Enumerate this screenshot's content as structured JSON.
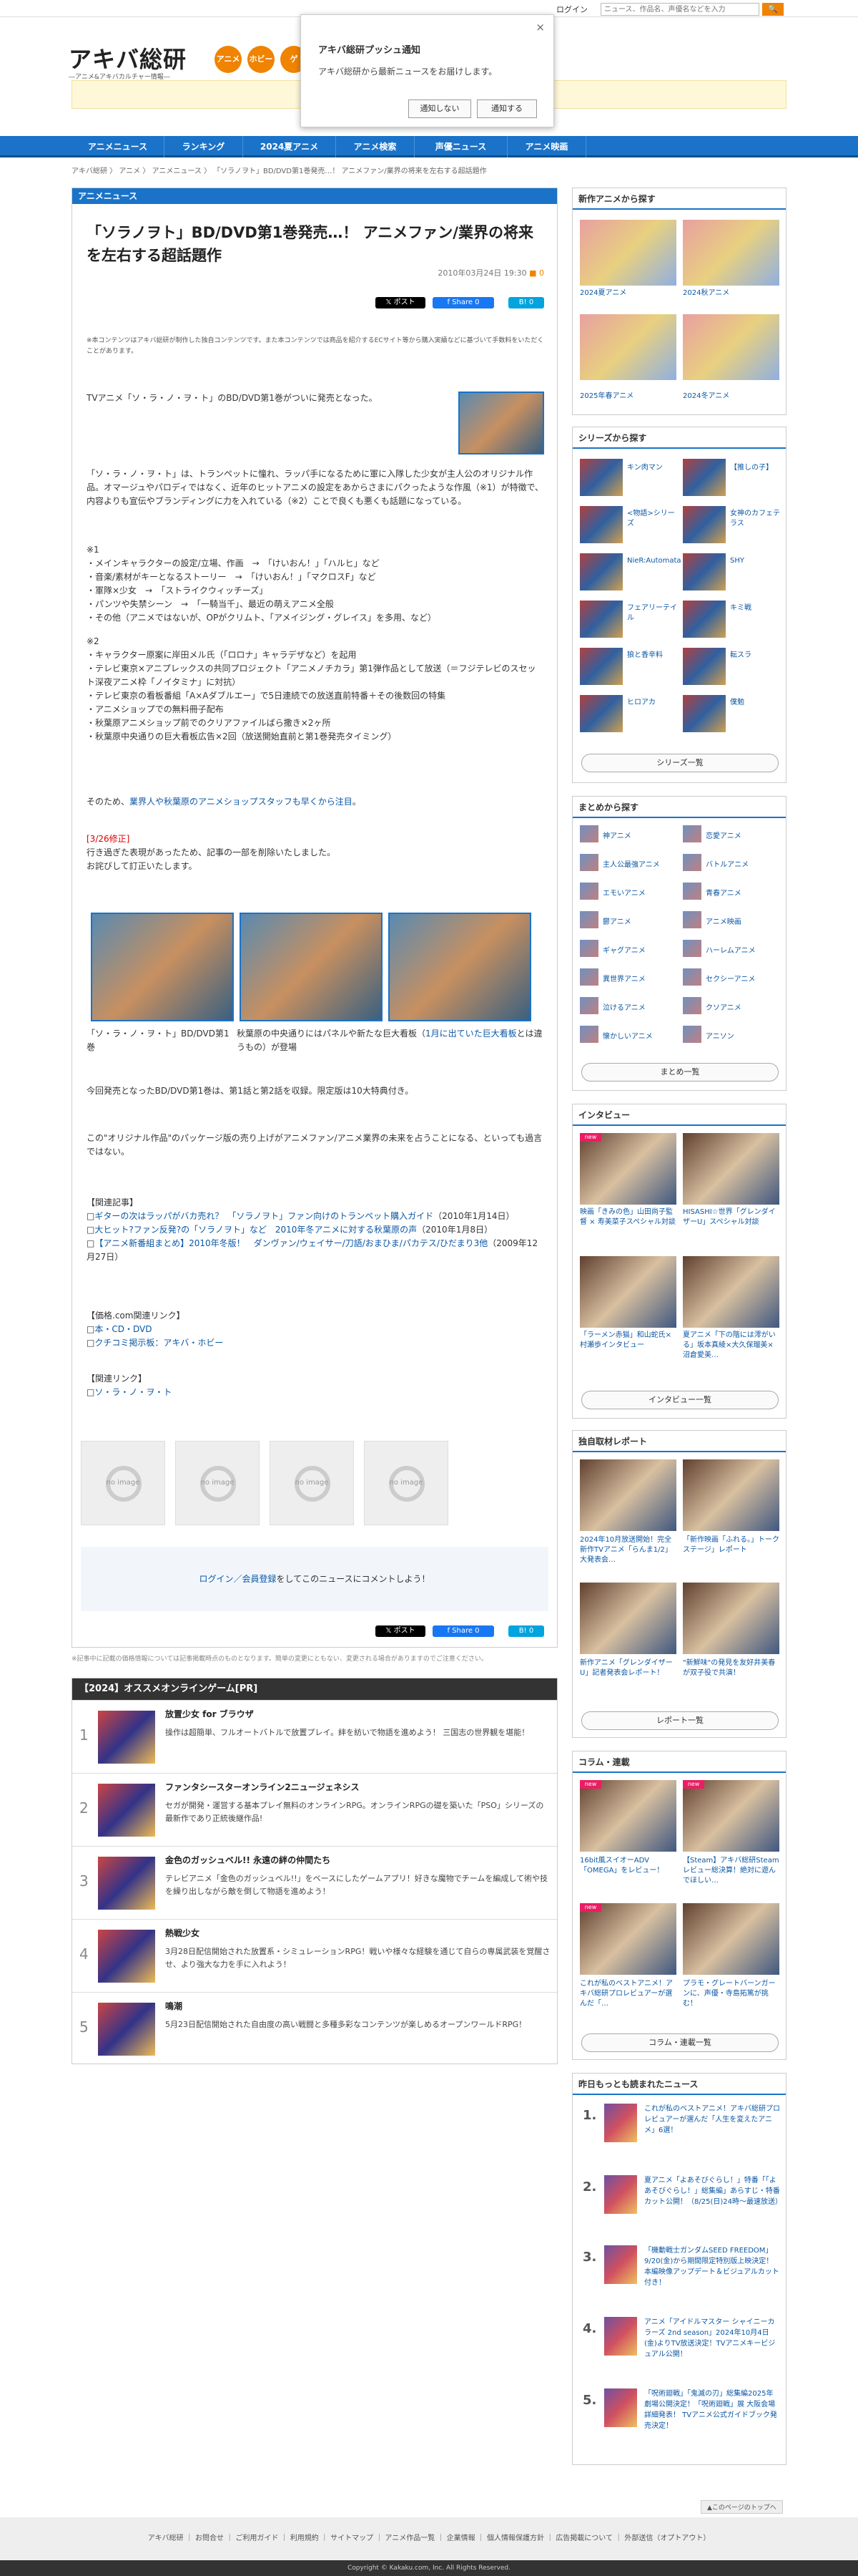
{
  "topbar": {
    "login": "ログイン",
    "search_placeholder": "ニュース、作品名、声優名などを入力",
    "search_button": "🔍"
  },
  "logo": {
    "text": "アキバ総研",
    "sub": "―アニメ&アキバカルチャー情報―"
  },
  "circles": [
    "アニメ",
    "ホビー",
    "ゲ"
  ],
  "popup": {
    "title": "アキバ総研プッシュ通知",
    "body": "アキバ総研から最新ニュースをお届けします。",
    "deny": "通知しない",
    "allow": "通知する",
    "close": "×"
  },
  "nav": [
    "アニメニュース",
    "ランキング",
    "2024夏アニメ",
    "アニメ検索",
    "声優ニュース",
    "アニメ映画"
  ],
  "breadcrumb": "アキバ総研 〉 アニメ 〉 アニメニュース 〉 「ソラノヲト」BD/DVD第1巻発売…！ アニメファン/業界の将来を左右する超話題作",
  "article": {
    "section": "アニメニュース",
    "title": "「ソラノヲト」BD/DVD第1巻発売…！ アニメファン/業界の将来を左右する超話題作",
    "date": "2010年03月24日 19:30",
    "comments": "0",
    "share": [
      "𝕏 ポスト",
      "f Share 0",
      "B! 0"
    ],
    "note": "※本コンテンツはアキバ総研が制作した独自コンテンツです。また本コンテンツでは商品を紹介するECサイト等から購入実績などに基づいて手数料をいただくことがあります。",
    "p1": "TVアニメ「ソ・ラ・ノ・ヲ・ト」のBD/DVD第1巻がついに発売となった。",
    "p2": "「ソ・ラ・ノ・ヲ・ト」は、トランペットに憧れ、ラッパ手になるために軍に入隊した少女が主人公のオリジナル作品。オマージュやパロディではなく、近年のヒットアニメの設定をあからさまにパクったような作風（※1）が特徴で、内容よりも宣伝やブランディングに力を入れている（※2）ことで良くも悪くも話題になっている。",
    "list1_title": "※1",
    "list1": [
      "・メインキャラクターの設定/立場、作画　→　「けいおん！」「ハルヒ」など",
      "・音楽/素材がキーとなるストーリー　→　「けいおん！」「マクロスF」など",
      "・軍隊×少女　→　「ストライクウィッチーズ」",
      "・パンツや失禁シーン　→　「一騎当千」、最近の萌えアニメ全般",
      "・その他（アニメではないが、OPがクリムト、「アメイジング・グレイス」を多用、など）"
    ],
    "list2_title": "※2",
    "list2": [
      "・キャラクター原案に岸田メル氏（「ロロナ」キャラデザなど）を起用",
      "・テレビ東京×アニプレックスの共同プロジェクト「アニメノチカラ」第1弾作品として放送（＝フジテレビのスセット深夜アニメ枠「ノイタミナ」に対抗）",
      "・テレビ東京の看板番組「A×Aダブルエー」で5日連続での放送直前特番＋その後数回の特集",
      "・アニメショップでの無料冊子配布",
      "・秋葉原アニメショップ前でのクリアファイルばら撒き×2ヶ所",
      "・秋葉原中央通りの巨大看板広告×2回（放送開始直前と第1巻発売タイミング）"
    ],
    "p3a": "そのため、",
    "p3link": "業界人や秋葉原のアニメショップスタッフも早くから注目",
    "p3b": "。",
    "fix_label": "[3/26修正]",
    "fix_body": "行き過ぎた表現があったため、記事の一部を削除いたしました。",
    "fix_body2": "お詫びして訂正いたします。",
    "caption1": "「ソ・ラ・ノ・ヲ・ト」BD/DVD第1巻",
    "caption2": "秋葉原の中央通りにはパネルや新たな巨大看板（",
    "caption2_link": "1月に出ていた巨大看板",
    "caption2_b": "とは違うもの）が登場",
    "p4": "今回発売となったBD/DVD第1巻は、第1話と第2話を収録。限定版は10大特典付き。",
    "p5": "この\"オリジナル作品\"のパッケージ版の売り上げがアニメファン/アニメ業界の未来を占うことになる、といっても過言ではない。",
    "related_title": "【関連記事】",
    "related": [
      {
        "link": "ギターの次はラッパがバカ売れ？　「ソラノヲト」ファン向けのトランペット購入ガイド",
        "date": "（2010年1月14日）"
      },
      {
        "link": "大ヒット?ファン反発?の「ソラノヲト」など　2010年冬アニメに対する秋葉原の声",
        "date": "（2010年1月8日）"
      },
      {
        "link": "【アニメ新番組まとめ】2010年冬版！　ダンヴァン/ウェイサー/刀語/おまひま/パカテス/ひだまり3他",
        "date": "（2009年12月27日）"
      }
    ],
    "price_title": "【価格.com関連リンク】",
    "price": [
      "本・CD・DVD",
      "クチコミ掲示板：アキバ・ホビー"
    ],
    "link_title": "【関連リンク】",
    "links": [
      "ソ・ラ・ノ・ヲ・ト"
    ],
    "noimage": [
      "no image",
      "no image",
      "no image",
      "no image"
    ],
    "comment_link": "ログイン／会員登録",
    "comment_text": "をしてこのニュースにコメントしよう！"
  },
  "footnote": "※記事中に記載の価格情報については記事掲載時点のものとなります。簡単の変更にともない、変更される場合がありますのでご注意ください。",
  "ranking": {
    "title": "【2024】オススメオンラインゲーム[PR]",
    "items": [
      {
        "num": "1",
        "name": "放置少女 for ブラウザ",
        "desc": "操作は超簡単、フルオートバトルで放置プレイ。絆を紡いで物語を進めよう！ 三国志の世界観を堪能！"
      },
      {
        "num": "2",
        "name": "ファンタシースターオンライン2ニュージェネシス",
        "desc": "セガが開発・運営する基本プレイ無料のオンラインRPG。オンラインRPGの礎を築いた「PSO」シリーズの最新作であり正統後継作品!"
      },
      {
        "num": "3",
        "name": "金色のガッシュベル!! 永遠の絆の仲間たち",
        "desc": "テレビアニメ「金色のガッシュベル!!」をベースにしたゲームアプリ！好きな魔物でチームを編成して術や技を繰り出しながら敵を倒して物語を進めよう！"
      },
      {
        "num": "4",
        "name": "熱戦少女",
        "desc": "3月28日配信開始された放置系・シミュレーションRPG！戦いや様々な経験を通じて自らの専属武装を覚醒させ、より強大な力を手に入れよう！"
      },
      {
        "num": "5",
        "name": "鳴潮",
        "desc": "5月23日配信開始された自由度の高い戦闘と多種多彩なコンテンツが楽しめるオープンワールドRPG！"
      }
    ]
  },
  "side_new": {
    "title": "新作アニメから探す",
    "items": [
      "2024夏アニメ",
      "2024秋アニメ",
      "2025年春アニメ",
      "2024冬アニメ"
    ]
  },
  "side_series": {
    "title": "シリーズから探す",
    "items": [
      "キン肉マン",
      "【推しの子】",
      "<物語>シリーズ",
      "女神のカフェテラス",
      "NieR:Automata",
      "SHY",
      "フェアリーテイル",
      "キミ戦",
      "狼と香辛料",
      "転スラ",
      "ヒロアカ",
      "僕勉"
    ],
    "more": "シリーズ一覧"
  },
  "side_matome": {
    "title": "まとめから探す",
    "items": [
      "神アニメ",
      "恋愛アニメ",
      "主人公最強アニメ",
      "バトルアニメ",
      "エモいアニメ",
      "青春アニメ",
      "鬱アニメ",
      "アニメ映画",
      "ギャグアニメ",
      "ハーレムアニメ",
      "異世界アニメ",
      "セクシーアニメ",
      "泣けるアニメ",
      "クソアニメ",
      "懐かしいアニメ",
      "アニソン"
    ],
    "more": "まとめ一覧"
  },
  "side_interview": {
    "title": "インタビュー",
    "items": [
      "映画「きみの色」山田尚子監督 × 寿美菜子スペシャル対談",
      "HISASHI☆世界「グレンダイザーU」スペシャル対談",
      "「ラーメン赤猫」和山蛇氏×村瀬歩インタビュー",
      "夏アニメ「下の階には澪がいる」坂本真綾×大久保瑠美×沼倉愛美…"
    ],
    "more": "インタビュー一覧"
  },
  "side_report": {
    "title": "独自取材レポート",
    "items": [
      "2024年10月放送開始！完全新作TVアニメ「らんま1/2」大発表会…",
      "「新作映画「ふれる。」トークステージ」レポート",
      "新作アニメ「グレンダイザーU」記者発表会レポート！",
      "\"新鮮味\"の発見を友好井美春が双子役で共演！"
    ],
    "more": "レポート一覧"
  },
  "side_column": {
    "title": "コラム・連載",
    "items": [
      "16bit風スイオーADV「OMEGA」をレビュー！",
      "【Steam】アキバ総研Steamレビュー総決算！絶対に遊んでほしい…",
      "これが私のベストアニメ！アキバ総研プロレビュアーが選んだ「…",
      "プラモ・グレートバーンガーンに、声優・寺島拓篤が挑む！"
    ],
    "more": "コラム・連載一覧"
  },
  "side_yesterday": {
    "title": "昨日もっとも読まれたニュース",
    "items": [
      {
        "num": "1.",
        "text": "これが私のベストアニメ！アキバ総研プロレビュアーが選んだ「人生を変えたアニメ」6選！"
      },
      {
        "num": "2.",
        "text": "夏アニメ「よあそびぐらし！」特番「「よあそびぐらし！」総集編」あらすじ・特番カット公開！（8/25(日)24時〜最速放送）"
      },
      {
        "num": "3.",
        "text": "「機動戦士ガンダムSEED FREEDOM」9/20(金)から期間限定特別版上映決定！本編映像アップデート＆ビジュアルカット付き！"
      },
      {
        "num": "4.",
        "text": "アニメ「アイドルマスター シャイニーカラーズ 2nd season」2024年10月4日(金)よりTV放送決定！TVアニメキービジュアル公開！"
      },
      {
        "num": "5.",
        "text": "「呪術廻戦」「鬼滅の刃」総集編2025年劇場公開決定！「呪術廻戦」展 大阪会場詳細発表！ TVアニメ公式ガイドブック発売決定！"
      }
    ]
  },
  "toplink": "▲このページのトップへ",
  "footer": "アキバ総研 ｜ お問合せ ｜ ご利用ガイド ｜ 利用規約 ｜ サイトマップ ｜ アニメ作品一覧 ｜ 企業情報 ｜ 個人情報保護方針 ｜ 広告掲載について ｜ 外部送信（オプトアウト）",
  "copyright": "Copyright © Kakaku.com, Inc. All Rights Reserved."
}
